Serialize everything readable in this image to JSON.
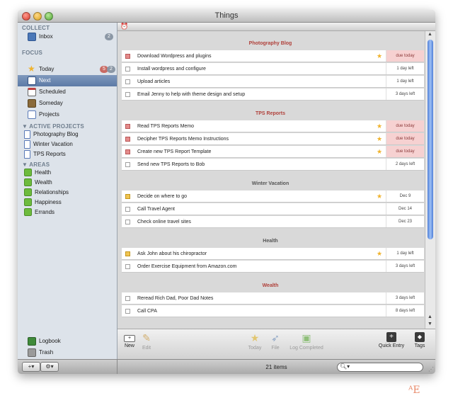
{
  "window": {
    "title": "Things"
  },
  "sidebar": {
    "collect": {
      "heading": "COLLECT",
      "items": [
        {
          "label": "Inbox",
          "badge": "2",
          "icon": "inbox-icon"
        }
      ]
    },
    "focus": {
      "heading": "FOCUS",
      "items": [
        {
          "label": "Today",
          "badge_red": "5",
          "badge": "2",
          "icon": "star-icon"
        },
        {
          "label": "Next",
          "icon": "next-list-icon",
          "selected": true
        },
        {
          "label": "Scheduled",
          "icon": "calendar-icon"
        },
        {
          "label": "Someday",
          "icon": "box-icon"
        },
        {
          "label": "Projects",
          "icon": "projects-icon"
        }
      ]
    },
    "active_projects": {
      "heading": "▼ ACTIVE PROJECTS",
      "items": [
        {
          "label": "Photography Blog"
        },
        {
          "label": "Winter Vacation"
        },
        {
          "label": "TPS Reports"
        }
      ]
    },
    "areas": {
      "heading": "▼ AREAS",
      "items": [
        {
          "label": "Health"
        },
        {
          "label": "Wealth"
        },
        {
          "label": "Relationships"
        },
        {
          "label": "Happiness"
        },
        {
          "label": "Errands"
        }
      ]
    },
    "logbook": "Logbook",
    "trash": "Trash",
    "add_button": "+▾",
    "gear_button": "⚙▾"
  },
  "groups": [
    {
      "title": "Photography Blog",
      "color": "#b0403a",
      "tasks": [
        {
          "title": "Download Wordpress and plugins",
          "box": "red",
          "star": true,
          "due": "due today",
          "hot": true
        },
        {
          "title": "Install wordpress and configure",
          "box": "",
          "star": false,
          "due": "1 day left",
          "hot": false
        },
        {
          "title": "Upload articles",
          "box": "",
          "star": false,
          "due": "1 day left",
          "hot": false
        },
        {
          "title": "Email Jenny to help with theme design and setup",
          "box": "",
          "star": false,
          "due": "3 days left",
          "hot": false
        }
      ]
    },
    {
      "title": "TPS Reports",
      "color": "#b0403a",
      "tasks": [
        {
          "title": "Read TPS Reports Memo",
          "box": "red",
          "star": true,
          "due": "due today",
          "hot": true
        },
        {
          "title": "Decipher TPS Reports Memo Instructions",
          "box": "red",
          "star": true,
          "due": "due today",
          "hot": true
        },
        {
          "title": "Create new TPS Report Template",
          "box": "red",
          "star": true,
          "due": "due today",
          "hot": true
        },
        {
          "title": "Send new TPS Reports to Bob",
          "box": "",
          "star": false,
          "due": "2 days left",
          "hot": false
        }
      ]
    },
    {
      "title": "Winter Vacation",
      "color": "#555555",
      "tasks": [
        {
          "title": "Decide on where to go",
          "box": "yellow",
          "star": true,
          "due": "Dec 9",
          "hot": false
        },
        {
          "title": "Call Travel Agent",
          "box": "",
          "star": false,
          "due": "Dec 14",
          "hot": false
        },
        {
          "title": "Check online travel sites",
          "box": "",
          "star": false,
          "due": "Dec 23",
          "hot": false
        }
      ]
    },
    {
      "title": "Health",
      "color": "#555555",
      "tasks": [
        {
          "title": "Ask John about his chiropractor",
          "box": "yellow",
          "star": true,
          "due": "1 day left",
          "hot": false
        },
        {
          "title": "Order Exercise Equipment from Amazon.com",
          "box": "",
          "star": false,
          "due": "3 days left",
          "hot": false
        }
      ]
    },
    {
      "title": "Wealth",
      "color": "#b0403a",
      "tasks": [
        {
          "title": "Reread Rich Dad, Poor Dad Notes",
          "box": "",
          "star": false,
          "due": "3 days left",
          "hot": false
        },
        {
          "title": "Call CPA",
          "box": "",
          "star": false,
          "due": "8 days left",
          "hot": false
        }
      ]
    }
  ],
  "toolbar": {
    "new": "New",
    "edit": "Edit",
    "today": "Today",
    "file": "File",
    "log_completed": "Log Completed",
    "quick_entry": "Quick Entry",
    "tags": "Tags"
  },
  "status": {
    "count": "21 items",
    "search_placeholder": ""
  }
}
